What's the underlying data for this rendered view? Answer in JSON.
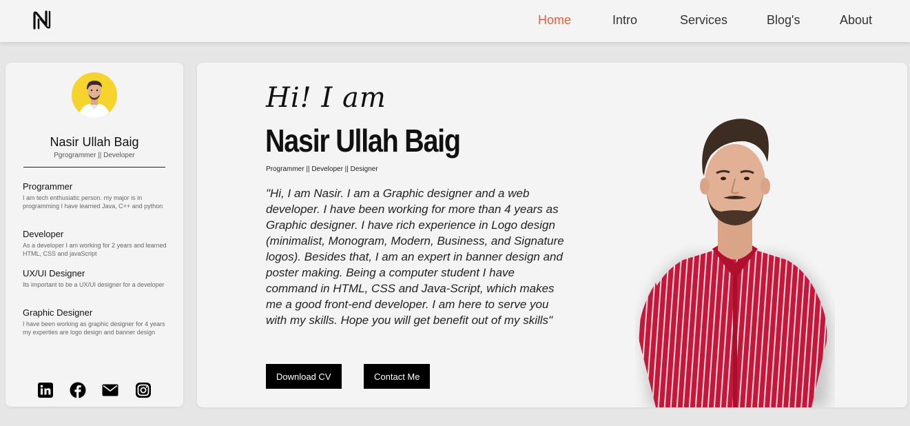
{
  "nav": {
    "logo_icon": "n-monogram-logo",
    "links": [
      {
        "label": "Home",
        "active": true
      },
      {
        "label": "Intro",
        "active": false
      },
      {
        "label": "Services",
        "active": false
      },
      {
        "label": "Blog's",
        "active": false
      },
      {
        "label": "About",
        "active": false
      }
    ],
    "active_color": "#ef5a3c"
  },
  "sidebar": {
    "avatar_icon": "profile-photo",
    "avatar_bg": "#f6d32d",
    "name": "Nasir Ullah Baig",
    "role": "Pgrogrammer || Developer",
    "skills": [
      {
        "title": "Programmer",
        "desc": "I am tech enthusiatic person. my major is in programming I have learned Java, C++ and python"
      },
      {
        "title": "Developer",
        "desc": "As a developer I am working for 2 years and learned HTML, CSS and javaScript"
      },
      {
        "title": "UX/UI Designer",
        "desc": "Its important to be a UX/UI designer for a developer"
      },
      {
        "title": "Graphic Designer",
        "desc": "I have been working as graphic designer for 4 years my experties are logo design and banner design"
      }
    ],
    "socials": [
      "linkedin-icon",
      "facebook-icon",
      "mail-icon",
      "instagram-icon"
    ]
  },
  "hero": {
    "greeting": "Hi! I am",
    "name": "Nasir Ullah Baig",
    "role": "Programmer || Developer || Designer",
    "bio": "\"Hi, I am Nasir. I am a Graphic designer and a web developer. I have been working for more than 4 years as Graphic designer. I have rich experience in Logo design (minimalist, Monogram, Modern, Business, and Signature logos). Besides that, I am an expert in banner design and poster making. Being a computer student I have command in HTML, CSS and Java-Script, which makes me a good front-end developer. I am here to serve you with my skills. Hope you will get benefit out of my skills\"",
    "download_cv_label": "Download CV",
    "contact_label": "Contact Me",
    "portrait_icon": "portrait-photo",
    "shirt_color": "#c8163a"
  }
}
